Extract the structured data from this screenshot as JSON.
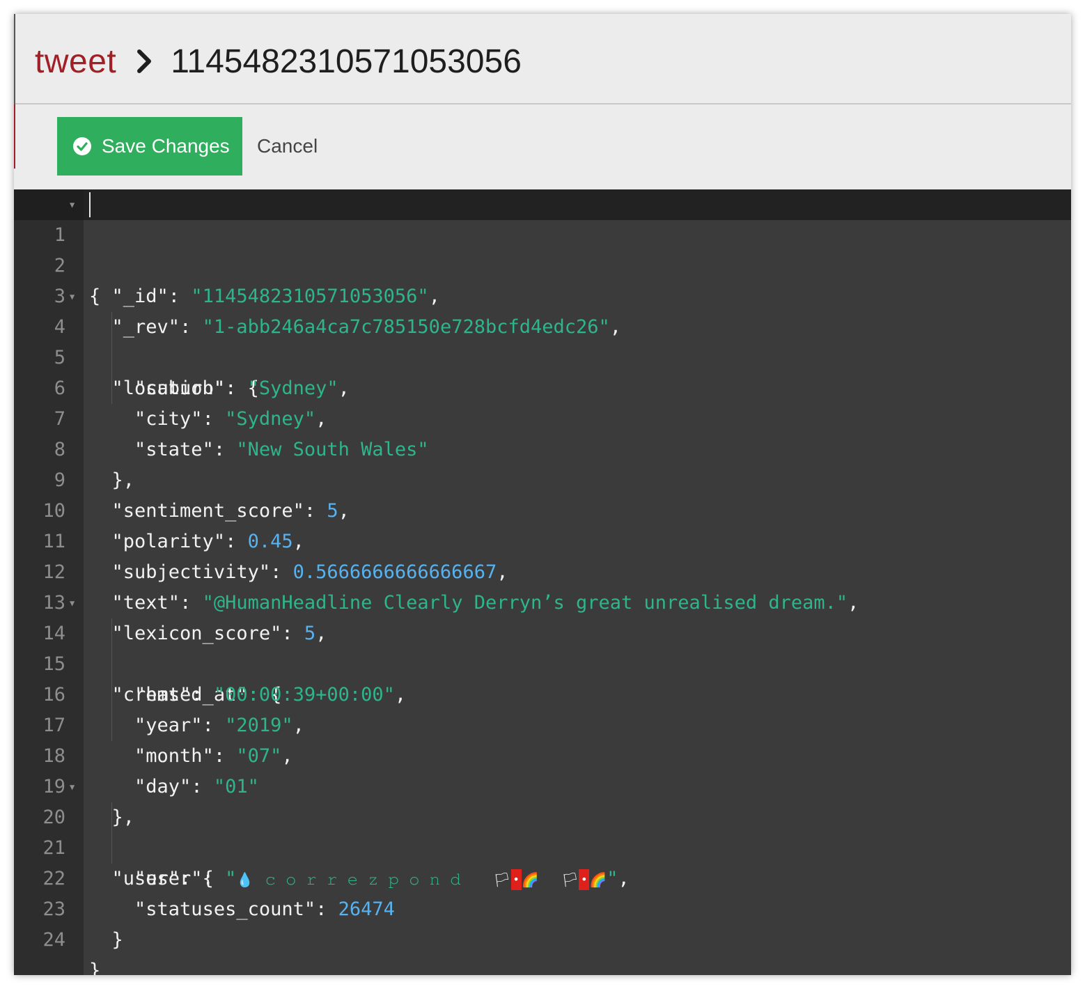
{
  "header": {
    "database": "tweet",
    "document_id": "1145482310571053056"
  },
  "toolbar": {
    "save_label": "Save Changes",
    "cancel_label": "Cancel"
  },
  "editor": {
    "line_numbers": [
      "1",
      "2",
      "3",
      "4",
      "5",
      "6",
      "7",
      "8",
      "9",
      "10",
      "11",
      "12",
      "13",
      "14",
      "15",
      "16",
      "17",
      "18",
      "19",
      "20",
      "21",
      "22",
      "23",
      "24"
    ],
    "doc": {
      "id_key": "\"_id\"",
      "id_val": "\"1145482310571053056\"",
      "rev_key": "\"_rev\"",
      "rev_val": "\"1-abb246a4ca7c785150e728bcfd4edc26\"",
      "location_key": "\"location\"",
      "suburb_key": "\"suburb\"",
      "suburb_val": "\"Sydney\"",
      "city_key": "\"city\"",
      "city_val": "\"Sydney\"",
      "state_key": "\"state\"",
      "state_val": "\"New South Wales\"",
      "sentiment_key": "\"sentiment_score\"",
      "sentiment_val": "5",
      "polarity_key": "\"polarity\"",
      "polarity_val": "0.45",
      "subjectivity_key": "\"subjectivity\"",
      "subjectivity_val": "0.5666666666666667",
      "text_key": "\"text\"",
      "text_val": "\"@HumanHeadline Clearly Derryn’s great unrealised dream.\"",
      "lexicon_key": "\"lexicon_score\"",
      "lexicon_val": "5",
      "created_key": "\"created_at\"",
      "hms_key": "\"hms\"",
      "hms_val": "\"00:00:39+00:00\"",
      "year_key": "\"year\"",
      "year_val": "\"2019\"",
      "month_key": "\"month\"",
      "month_val": "\"07\"",
      "day_key": "\"day\"",
      "day_val": "\"01\"",
      "user_obj_key": "\"user\"",
      "user_key": "\"user\"",
      "user_val_open": "\"",
      "user_droplet": "💧",
      "user_name": "𝚌𝚘𝚛𝚛𝚎𝚣𝚙𝚘𝚗𝚍",
      "user_flag_1": "🏳",
      "user_red_1": "•",
      "user_rainbow_1": "🌈",
      "user_flag_2": "🏳",
      "user_red_2": "•",
      "user_rainbow_2": "🌈",
      "user_val_close": "\"",
      "statuses_key": "\"statuses_count\"",
      "statuses_val": "26474"
    }
  },
  "colors": {
    "database_crumb": "#a11f26",
    "save_button": "#2fae5d",
    "editor_bg": "#3b3b3b",
    "gutter_bg": "#2d2d2d",
    "string": "#2fb58b",
    "number": "#56b3f0"
  },
  "icons": {
    "breadcrumb_separator": "chevron-right-icon",
    "save": "check-circle-icon",
    "fold": "fold-arrow-icon"
  }
}
